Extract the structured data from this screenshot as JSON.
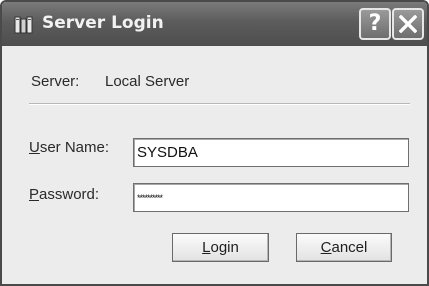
{
  "window": {
    "title": "Server Login",
    "help_glyph": "?",
    "icon": "server-icon"
  },
  "server": {
    "label": "Server:",
    "value": "Local Server"
  },
  "username": {
    "label_mnemonic": "U",
    "label_rest": "ser Name:",
    "value": "SYSDBA"
  },
  "password": {
    "label_mnemonic": "P",
    "label_rest": "assword:",
    "masked_value": "**********"
  },
  "buttons": {
    "login_mnemonic": "L",
    "login_rest": "ogin",
    "cancel_mnemonic": "C",
    "cancel_rest": "ancel"
  },
  "colors": {
    "titlebar": "#5c5c5c",
    "window_bg": "#ececec",
    "field_bg": "#ffffff"
  }
}
